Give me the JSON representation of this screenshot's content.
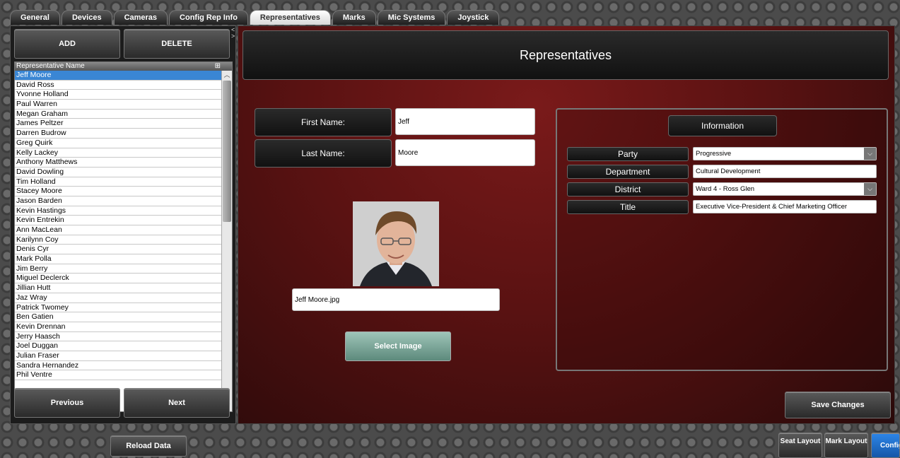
{
  "tabs": [
    "General",
    "Devices",
    "Cameras",
    "Config Rep Info",
    "Representatives",
    "Marks",
    "Mic Systems",
    "Joystick"
  ],
  "active_tab": "Representatives",
  "left": {
    "add_label": "ADD",
    "delete_label": "DELETE",
    "list_header": "Representative Name",
    "selected": "Jeff Moore",
    "reps": [
      "Jeff Moore",
      "David Ross",
      "Yvonne Holland",
      "Paul Warren",
      "Megan Graham",
      "James Peltzer",
      "Darren Budrow",
      "Greg Quirk",
      "Kelly Lackey",
      "Anthony Matthews",
      "David Dowling",
      "Tim Holland",
      "Stacey Moore",
      "Jason Barden",
      "Kevin Hastings",
      "Kevin Entrekin",
      "Ann MacLean",
      "Karilynn Coy",
      "Denis Cyr",
      "Mark Polla",
      "Jim Berry",
      "Miguel Declerck",
      "Jillian Hutt",
      "Jaz Wray",
      "Patrick Twomey",
      "Ben Gatien",
      "Kevin Drennan",
      "Jerry Haasch",
      "Joel Duggan",
      "Julian Fraser",
      "Sandra Hernandez",
      "Phil Ventre"
    ],
    "previous_label": "Previous",
    "next_label": "Next"
  },
  "main": {
    "title": "Representatives",
    "first_name_label": "First Name:",
    "first_name_value": "Jeff",
    "last_name_label": "Last Name:",
    "last_name_value": "Moore",
    "image_filename": "Jeff Moore.jpg",
    "select_image_label": "Select Image",
    "save_label": "Save Changes"
  },
  "info": {
    "title": "Information",
    "party_label": "Party",
    "party_value": "Progressive",
    "department_label": "Department",
    "department_value": "Cultural Development",
    "district_label": "District",
    "district_value": "Ward 4 - Ross Glen",
    "title_label": "Title",
    "title_value": "Executive Vice-President & Chief Marketing Officer"
  },
  "bottom": {
    "reload_label": "Reload Data",
    "seat_layout_label": "Seat Layout",
    "mark_layout_label": "Mark Layout",
    "config_label": "Config"
  },
  "colors": {
    "selection": "#3a86d4",
    "accent_green": "#7fae9f",
    "main_red": "#6a1616",
    "config_blue": "#1e6fd0"
  }
}
